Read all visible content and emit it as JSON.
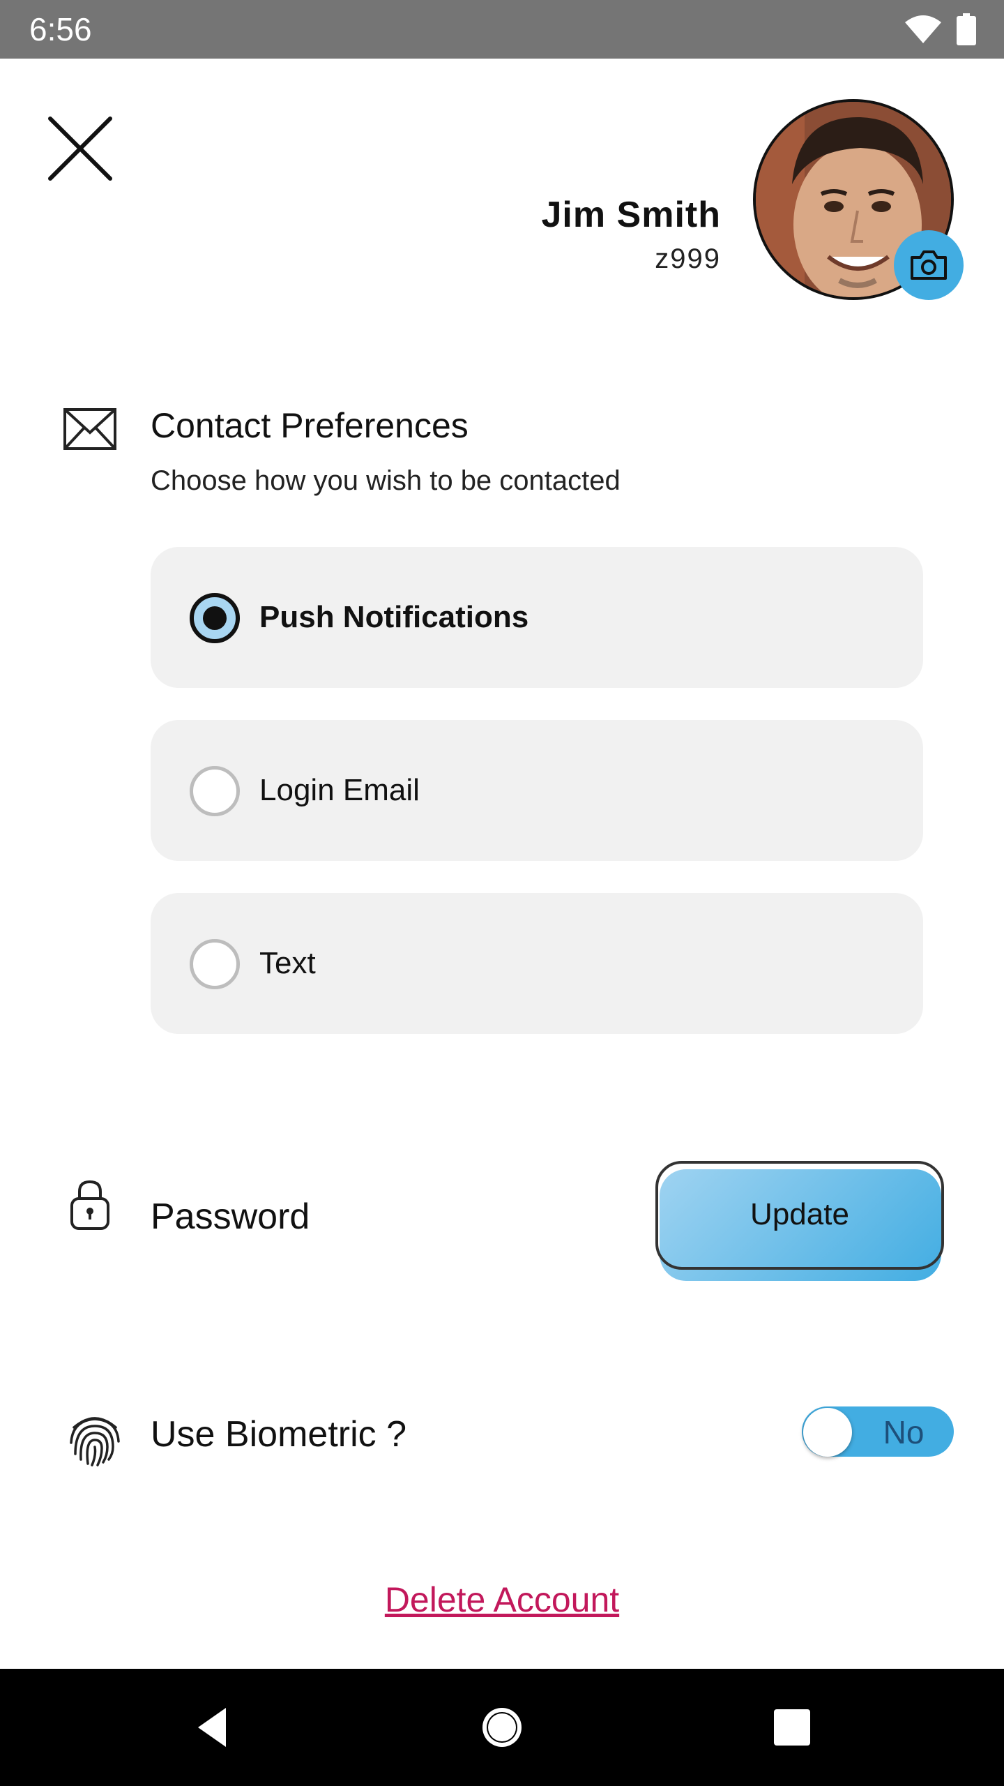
{
  "status_bar": {
    "time": "6:56",
    "icons": [
      "wifi-icon",
      "battery-icon"
    ]
  },
  "header": {
    "close_icon": "close-icon"
  },
  "profile": {
    "name": "Jim Smith",
    "user_id": "z999",
    "camera_icon": "camera-icon"
  },
  "contact_preferences": {
    "icon": "mail-icon",
    "title": "Contact Preferences",
    "subtitle": "Choose how you wish to be contacted",
    "options": [
      {
        "label": "Push Notifications",
        "selected": true
      },
      {
        "label": "Login Email",
        "selected": false
      },
      {
        "label": "Text",
        "selected": false
      }
    ]
  },
  "password": {
    "icon": "lock-icon",
    "label": "Password",
    "button_label": "Update"
  },
  "biometric": {
    "icon": "fingerprint-icon",
    "label": "Use Biometric ?",
    "toggle_text": "No",
    "enabled": false
  },
  "delete_account": {
    "label": "Delete Account"
  },
  "colors": {
    "accent": "#42ade2",
    "danger": "#c2185b",
    "status_bar": "#757575",
    "option_bg": "#f1f1f1"
  },
  "nav_bar": {
    "icons": [
      "back-icon",
      "home-icon",
      "recents-icon"
    ]
  }
}
